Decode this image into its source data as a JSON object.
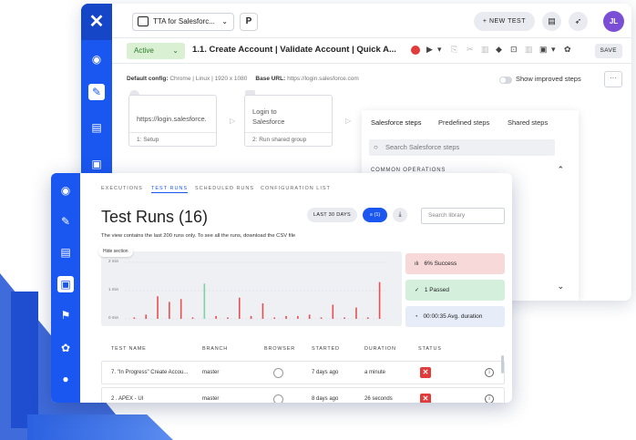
{
  "back_window": {
    "logo_glyph": "✕",
    "project": "TTA for Salesforc...",
    "branch_glyph": "P",
    "new_test_label": "+ NEW TEST",
    "avatar_initials": "JL",
    "status": "Active",
    "test_title": "1.1. Create Account | Validate Account | Quick A...",
    "save_label": "SAVE",
    "config_default_label": "Default config:",
    "config_default_value": "Chrome | Linux | 1920 x 1080",
    "config_base_label": "Base URL:",
    "config_base_value": "https://login.salesforce.com",
    "toggle_label": "Show improved steps",
    "more_label": "···",
    "steps": [
      {
        "body": "https://login.salesforce.",
        "foot": "1: Setup"
      },
      {
        "body": "Login to\nSalesforce",
        "foot": "2: Run shared group"
      }
    ],
    "dropdown": {
      "tabs": [
        "Salesforce steps",
        "Predefined steps",
        "Shared steps"
      ],
      "search_placeholder": "Search Salesforce steps",
      "section": "COMMON OPERATIONS"
    }
  },
  "front_window": {
    "nav_tabs": [
      "EXECUTIONS",
      "TEST RUNS",
      "SCHEDULED RUNS",
      "CONFIGURATION LIST"
    ],
    "active_nav": "TEST RUNS",
    "title": "Test Runs (16)",
    "range_label": "LAST 30 DAYS",
    "filter_label": "≡ (1)",
    "download_glyph": "⤓",
    "search_placeholder": "Search library",
    "note": "The view contains the last 200 runs only. To see all the runs, download the CSV file",
    "hide_section_label": "Hide section",
    "y_ticks": [
      "2 min",
      "1 min",
      "0 min"
    ],
    "stats": [
      {
        "icon": "ılı",
        "label": "6% Success",
        "bg": "#f8d9d9"
      },
      {
        "icon": "✓",
        "label": "1 Passed",
        "bg": "#d4f0dc"
      },
      {
        "icon": "◔",
        "label": "00:00:35 Avg. duration",
        "bg": "#e6ecf8"
      }
    ],
    "columns": [
      "TEST NAME",
      "BRANCH",
      "BROWSER",
      "STARTED",
      "DURATION",
      "STATUS"
    ],
    "rows": [
      {
        "name": "7. \"In Progress\" Create Accou...",
        "branch": "master",
        "started": "7 days ago",
        "duration": "a minute",
        "status": "failed"
      },
      {
        "name": "2 . APEX - UI",
        "branch": "master",
        "started": "8 days ago",
        "duration": "26 seconds",
        "status": "failed"
      }
    ]
  },
  "chart_data": {
    "type": "bar",
    "ylabel": "",
    "ylim": [
      0,
      2
    ],
    "y_unit": "min",
    "colors": {
      "failed": "#e85050",
      "passed": "#7ed3a0"
    },
    "values": [
      0.05,
      0.15,
      0.8,
      0.6,
      0.7,
      0.05,
      1.25,
      0.1,
      0.05,
      0.75,
      0.1,
      0.55,
      0.05,
      0.1,
      0.1,
      0.15,
      0.05,
      0.5,
      0.05,
      0.4,
      0.05,
      1.3
    ],
    "status": [
      "failed",
      "failed",
      "failed",
      "failed",
      "failed",
      "failed",
      "passed",
      "failed",
      "failed",
      "failed",
      "failed",
      "failed",
      "failed",
      "failed",
      "failed",
      "failed",
      "failed",
      "failed",
      "failed",
      "failed",
      "failed",
      "failed"
    ]
  }
}
